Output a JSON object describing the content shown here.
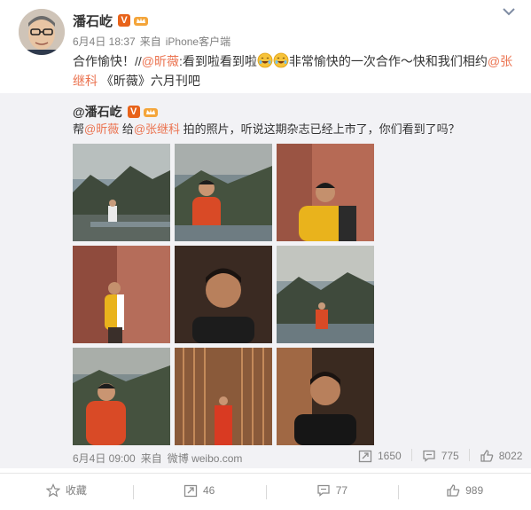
{
  "post": {
    "author": "潘石屹",
    "date": "6月4日 18:37",
    "source_prefix": "来自",
    "source": "iPhone客户端",
    "text_parts": [
      {
        "t": "合作愉快！//",
        "link": false
      },
      {
        "t": "@昕薇",
        "link": true
      },
      {
        "t": ":看到啦看到啦",
        "link": false
      },
      {
        "t": "emoji",
        "emoji": true
      },
      {
        "t": "emoji",
        "emoji": true
      },
      {
        "t": "非常愉快的一次合作～快和我们相约",
        "link": false
      },
      {
        "t": "@张继科",
        "link": true
      },
      {
        "t": " 《昕薇》六月刊吧",
        "link": false
      }
    ]
  },
  "repost": {
    "author": "@潘石屹",
    "text_parts": [
      {
        "t": "帮",
        "link": false
      },
      {
        "t": "@昕薇",
        "link": true
      },
      {
        "t": " 给",
        "link": false
      },
      {
        "t": "@张继科",
        "link": true
      },
      {
        "t": " 拍的照片，听说这期杂志已经上市了，你们看到了吗？",
        "link": false
      }
    ],
    "date": "6月4日 09:00",
    "source_prefix": "来自",
    "source": "微博 weibo.com",
    "stats": {
      "forward": "1650",
      "comment": "775",
      "like": "8022"
    },
    "photos": [
      "photo-1",
      "photo-2",
      "photo-3",
      "photo-4",
      "photo-5",
      "photo-6",
      "photo-7",
      "photo-8",
      "photo-9"
    ]
  },
  "actions": {
    "favorite": "收藏",
    "forward": "46",
    "comment": "77",
    "like": "989"
  },
  "colors": {
    "link": "#eb7350",
    "meta": "#808080",
    "repost_bg": "#f2f2f5",
    "vip": "#e8631a"
  },
  "icons": [
    "chevron-down-icon",
    "verified-v-icon",
    "vip-crown-icon",
    "forward-icon",
    "comment-icon",
    "like-icon",
    "star-icon",
    "laugh-emoji-icon"
  ]
}
